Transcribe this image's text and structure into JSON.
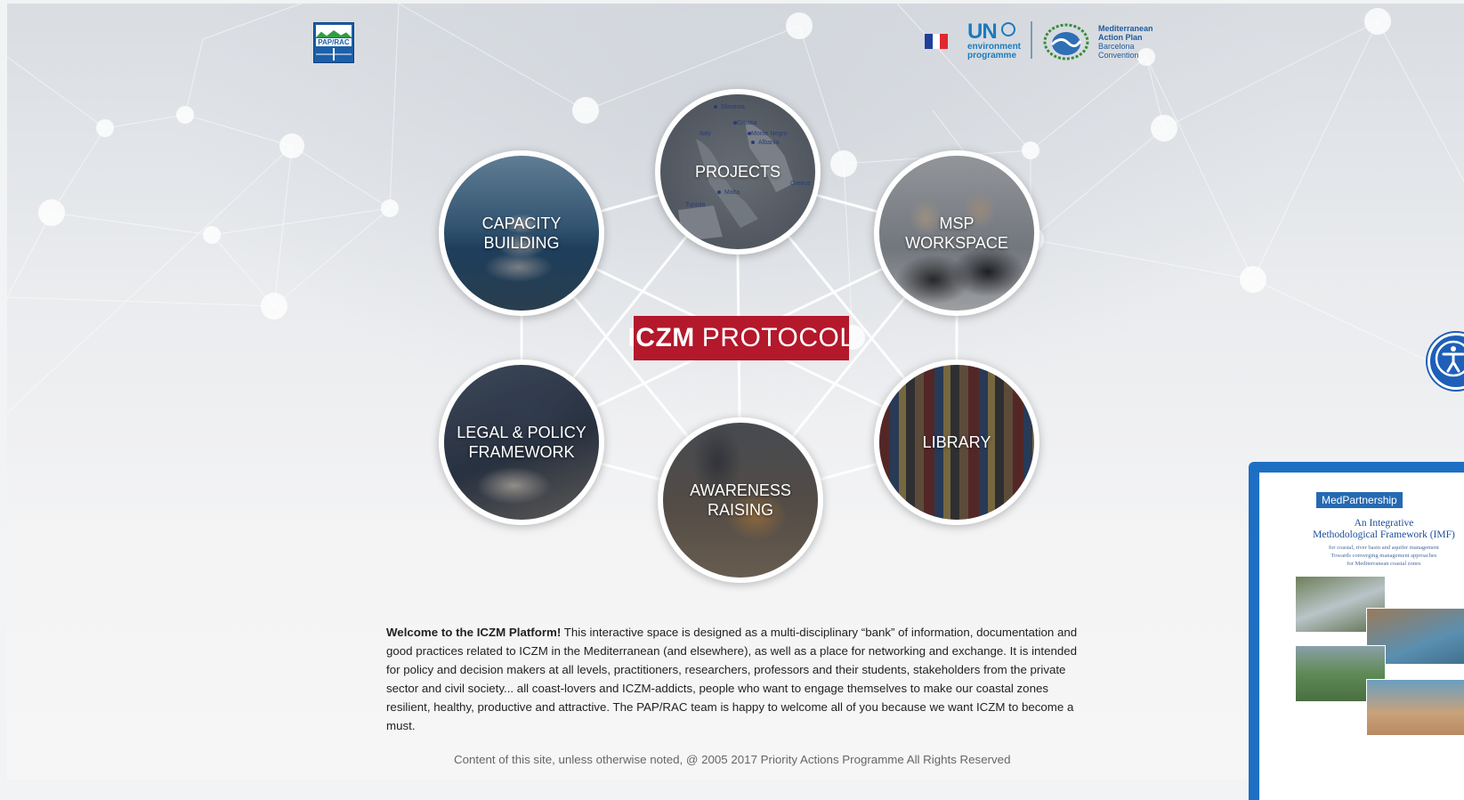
{
  "header": {
    "left_logo": {
      "name": "paprac-logo",
      "text": "PAP/RAC"
    },
    "right_logos": {
      "flag": {
        "name": "france-flag-icon",
        "colors": [
          "#1f3f9a",
          "#ffffff",
          "#e0282e"
        ]
      },
      "unep": {
        "line1": "UN",
        "line2": "environment",
        "line3": "programme"
      },
      "map": {
        "line1": "Mediterranean",
        "line2": "Action Plan",
        "line3": "Barcelona",
        "line4": "Convention"
      }
    }
  },
  "hub": {
    "center": {
      "strong": "ICZM",
      "light": "PROTOCOL",
      "color": "#b3182b"
    },
    "circles": [
      {
        "id": "projects",
        "label": "PROJECTS"
      },
      {
        "id": "capacity-building",
        "label": "CAPACITY\nBUILDING"
      },
      {
        "id": "msp-workspace",
        "label": "MSP WORKSPACE"
      },
      {
        "id": "legal-policy",
        "label": "LEGAL & POLICY\nFRAMEWORK"
      },
      {
        "id": "library",
        "label": "LIBRARY"
      },
      {
        "id": "awareness-raising",
        "label": "AWARENESS\nRAISING"
      }
    ],
    "projects_map_labels": [
      "Slovenia",
      "Croatia",
      "Italy",
      "Monte Negro",
      "Albania",
      "Malta",
      "Greece",
      "Tunisia"
    ]
  },
  "welcome": {
    "lead": "Welcome to the ICZM Platform!",
    "body": " This interactive space is designed as a multi-disciplinary “bank” of information, documentation and good practices related to ICZM in the Mediterranean (and elsewhere), as well as a place for networking and exchange. It is intended for policy and decision makers at all levels, practitioners, researchers, professors and their students, stakeholders from the private sector and civil society... all coast-lovers and ICZM-addicts, people who want to engage themselves to make our coastal zones resilient, healthy, productive and attractive. The PAP/RAC team is happy to welcome all of you because we want ICZM to become a must."
  },
  "footer": {
    "text": "Content of this site, unless otherwise noted, @ 2005 2017 Priority Actions Programme All Rights Reserved"
  },
  "accessibility": {
    "icon": "accessibility-icon"
  },
  "side_panel": {
    "badge": "MedPartnership",
    "title_line1": "An Integrative",
    "title_line2": "Methodological Framework (IMF)",
    "sub_line1": "for coastal, river basin and aquifer management",
    "sub_line2": "Towards converging management approaches",
    "sub_line3": "for Mediterranean coastal zones"
  }
}
